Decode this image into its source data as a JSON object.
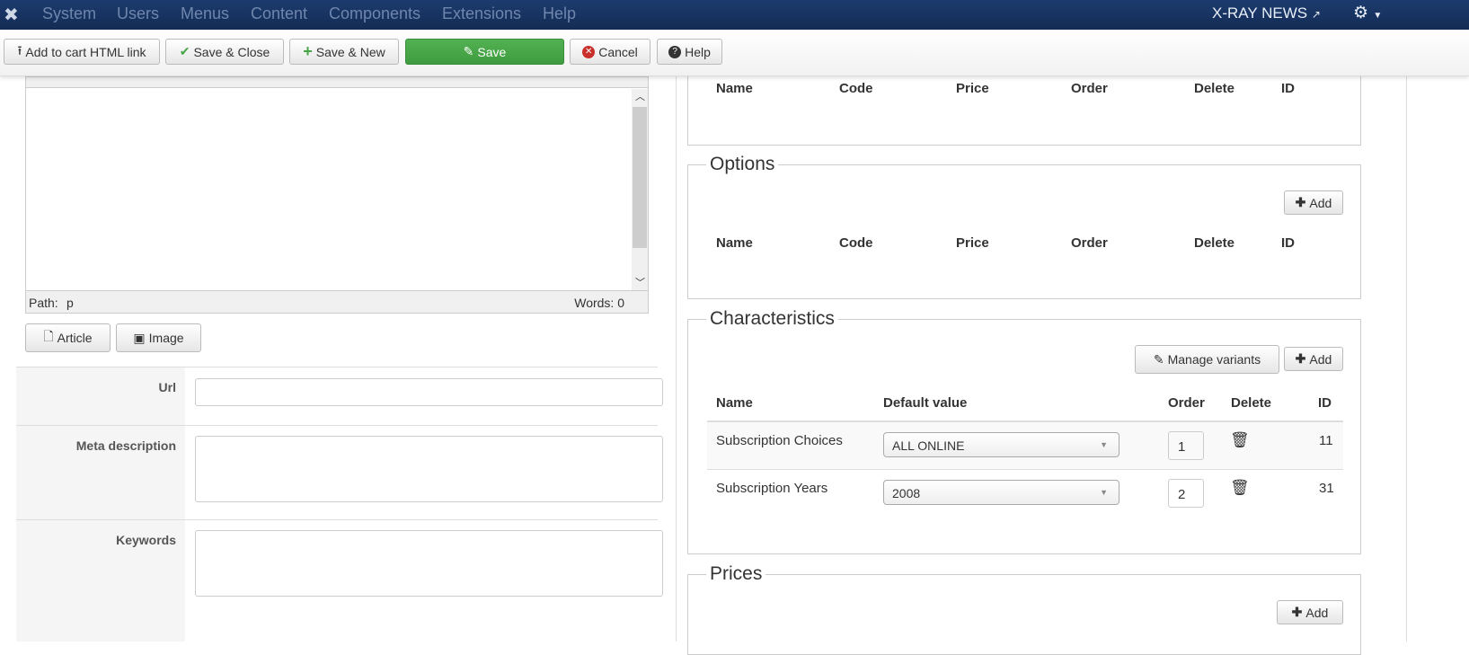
{
  "nav": {
    "menu": [
      "System",
      "Users",
      "Menus",
      "Content",
      "Components",
      "Extensions",
      "Help"
    ],
    "site": "X-RAY NEWS"
  },
  "toolbar": {
    "add_cart": "Add to cart HTML link",
    "save_close": "Save & Close",
    "save_new": "Save & New",
    "save": "Save",
    "cancel": "Cancel",
    "help": "Help"
  },
  "editor": {
    "path_label": "Path:",
    "path": "p",
    "words": "Words: 0",
    "article_btn": "Article",
    "image_btn": "Image"
  },
  "fields": {
    "url": "Url",
    "meta": "Meta description",
    "keywords": "Keywords"
  },
  "cols": {
    "name": "Name",
    "code": "Code",
    "price": "Price",
    "order": "Order",
    "delete": "Delete",
    "id": "ID",
    "default": "Default value"
  },
  "options": {
    "legend": "Options",
    "add": "Add"
  },
  "characteristics": {
    "legend": "Characteristics",
    "manage": "Manage variants",
    "add": "Add",
    "rows": [
      {
        "name": "Subscription Choices",
        "value": "ALL ONLINE",
        "order": "1",
        "id": "11"
      },
      {
        "name": "Subscription Years",
        "value": "2008",
        "order": "2",
        "id": "31"
      }
    ]
  },
  "prices": {
    "legend": "Prices",
    "add": "Add"
  },
  "colors": {
    "nav": "#1c3b6e",
    "save": "#46a546"
  }
}
